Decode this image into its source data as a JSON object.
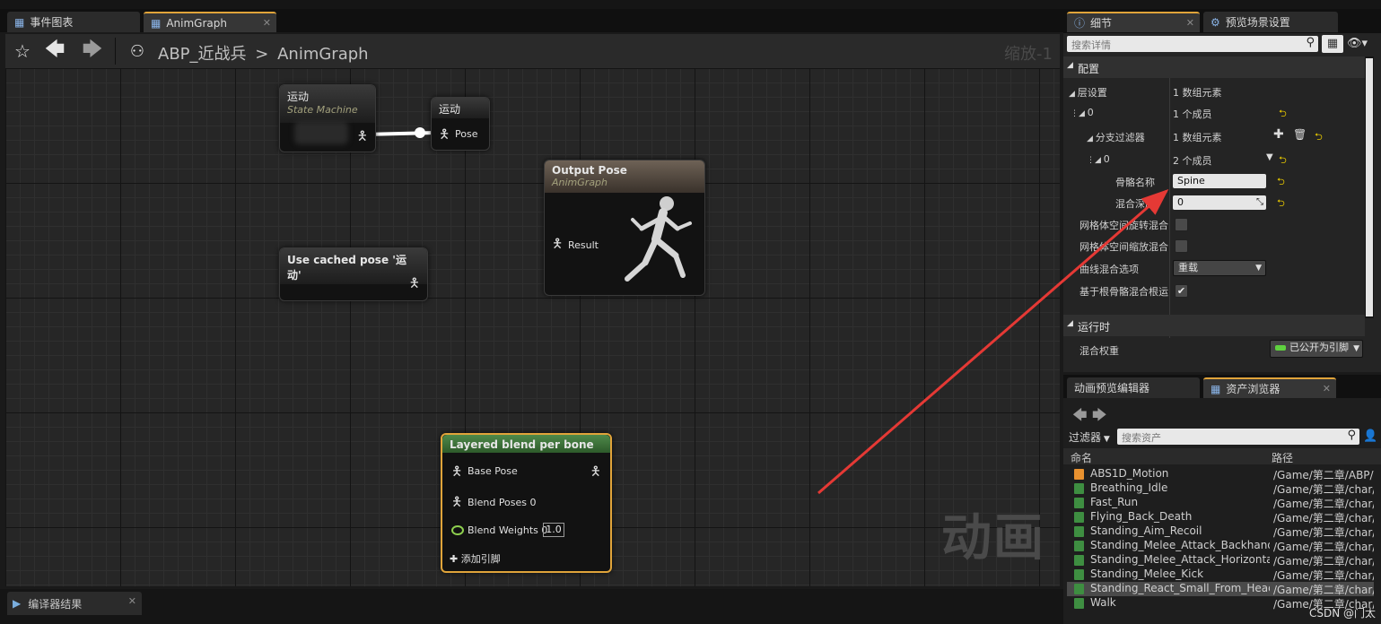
{
  "editor_tabs": [
    {
      "label": "事件图表",
      "active": false
    },
    {
      "label": "AnimGraph",
      "active": true
    }
  ],
  "breadcrumb": {
    "asset": "ABP_近战兵",
    "separator": ">",
    "graph": "AnimGraph"
  },
  "zoom_label": "缩放-1",
  "graph_watermark": "动画",
  "nodes": {
    "state_machine": {
      "title": "运动",
      "subtitle": "State Machine"
    },
    "pose_ref": {
      "title": "运动",
      "pin": "Pose"
    },
    "output_pose": {
      "title": "Output Pose",
      "subtitle": "AnimGraph",
      "pin": "Result"
    },
    "cached_pose": {
      "title": "Use cached pose '运动'"
    },
    "layered_blend": {
      "title": "Layered blend per bone",
      "pins": [
        "Base Pose",
        "Blend Poses 0",
        "Blend Weights 0"
      ],
      "blend_weight_value": "1.0",
      "add_pin_label": "添加引脚"
    }
  },
  "bottom_panel": {
    "tab_label": "编译器结果"
  },
  "details": {
    "tabs": [
      {
        "label": "细节"
      },
      {
        "label": "预览场景设置"
      }
    ],
    "search_placeholder": "搜索详情",
    "sections": {
      "config": "配置",
      "runtime": "运行时"
    },
    "rows": {
      "layer_setup": {
        "name": "层设置",
        "value": "1 数组元素"
      },
      "layer_0": {
        "name": "0",
        "value": "1 个成员"
      },
      "branch_filters": {
        "name": "分支过滤器",
        "value": "1 数组元素"
      },
      "filter_0": {
        "name": "0",
        "value": "2 个成员"
      },
      "bone_name": {
        "name": "骨骼名称",
        "value": "Spine"
      },
      "blend_depth": {
        "name": "混合深度",
        "value": "0"
      },
      "mesh_rotation_blend": {
        "name": "网格体空间旋转混合",
        "checked": false
      },
      "mesh_scale_blend": {
        "name": "网格体空间缩放混合",
        "checked": false
      },
      "curve_blend_option": {
        "name": "曲线混合选项",
        "value": "重载"
      },
      "root_bone_blend": {
        "name": "基于根骨骼混合根运",
        "checked": true
      },
      "blend_weight": {
        "name": "混合权重",
        "value": "已公开为引脚"
      }
    }
  },
  "asset_browser": {
    "tabs": [
      {
        "label": "动画预览编辑器"
      },
      {
        "label": "资产浏览器"
      }
    ],
    "filter_label": "过滤器",
    "search_placeholder": "搜索资产",
    "columns": [
      "命名",
      "路径"
    ],
    "items": [
      {
        "name": "ABS1D_Motion",
        "path": "/Game/第二章/ABP/",
        "type": "blendspace"
      },
      {
        "name": "Breathing_Idle",
        "path": "/Game/第二章/char/",
        "type": "anim"
      },
      {
        "name": "Fast_Run",
        "path": "/Game/第二章/char/",
        "type": "anim"
      },
      {
        "name": "Flying_Back_Death",
        "path": "/Game/第二章/char/",
        "type": "anim"
      },
      {
        "name": "Standing_Aim_Recoil",
        "path": "/Game/第二章/char/",
        "type": "anim"
      },
      {
        "name": "Standing_Melee_Attack_Backhand",
        "path": "/Game/第二章/char/",
        "type": "anim"
      },
      {
        "name": "Standing_Melee_Attack_Horizontal",
        "path": "/Game/第二章/char/",
        "type": "anim"
      },
      {
        "name": "Standing_Melee_Kick",
        "path": "/Game/第二章/char/",
        "type": "anim"
      },
      {
        "name": "Standing_React_Small_From_Headsh",
        "path": "/Game/第二章/char/",
        "type": "anim",
        "selected": true
      },
      {
        "name": "Walk",
        "path": "/Game/第二章/char/",
        "type": "anim"
      }
    ]
  },
  "watermark": "CSDN @门太",
  "colors": {
    "accent_orange": "#e0a43a",
    "annotation_arrow": "#e53935",
    "blend_node_header": "#3d6b3a",
    "reset_arrow": "#e2c400"
  }
}
